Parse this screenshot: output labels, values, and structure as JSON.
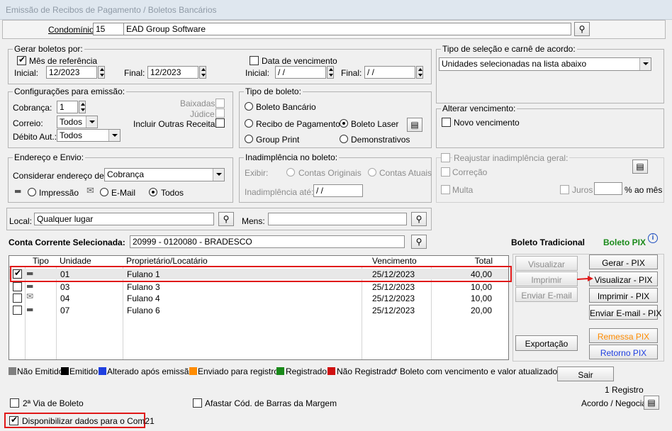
{
  "window": {
    "title": "Emissão de Recibos de Pagamento / Boletos Bancários"
  },
  "condominio": {
    "label": "Condomínio:",
    "code": "15",
    "name": "EAD Group Software"
  },
  "gerar": {
    "legend": "Gerar boletos por:",
    "mes_ref_label": "Mês de referência",
    "inicial_label": "Inicial:",
    "inicial": "12/2023",
    "final_label": "Final:",
    "final": "12/2023",
    "data_venc_label": "Data de vencimento",
    "venc_inicial_label": "Inicial:",
    "venc_inicial": " / /",
    "venc_final_label": "Final:",
    "venc_final": " / /"
  },
  "selecao": {
    "legend": "Tipo de seleção e carnê de acordo:",
    "value": "Unidades selecionadas na lista abaixo"
  },
  "config": {
    "legend": "Configurações para emissão:",
    "cobranca_label": "Cobrança:",
    "cobranca": "1",
    "correio_label": "Correio:",
    "correio": "Todos",
    "debito_label": "Débito Aut.:",
    "debito": "Todos",
    "baixadas": "Baixadas",
    "judice": "Júdice",
    "outras": "Incluir Outras Receitas"
  },
  "tipo_boleto": {
    "legend": "Tipo de boleto:",
    "bancario": "Boleto Bancário",
    "recibo": "Recibo de Pagamento",
    "laser": "Boleto Laser",
    "group": "Group Print",
    "demonstrativos": "Demonstrativos"
  },
  "alterar_venc": {
    "legend": "Alterar vencimento:",
    "novo": "Novo vencimento"
  },
  "endereco": {
    "legend": "Endereço e Envio:",
    "considerar_label": "Considerar endereço de:",
    "considerar": "Cobrança",
    "impressao": "Impressão",
    "email": "E-Mail",
    "todos": "Todos"
  },
  "inadimplencia": {
    "legend": "Inadimplência no boleto:",
    "exibir": "Exibir:",
    "originais": "Contas Originais",
    "atuais": "Contas Atuais",
    "ate_label": "Inadimplência até:",
    "ate": " / /"
  },
  "reajustar": {
    "legend": "Reajustar inadimplência geral:",
    "correcao": "Correção",
    "multa": "Multa",
    "juros": "Juros",
    "ao_mes": "% ao mês"
  },
  "local": {
    "label": "Local:",
    "value": "Qualquer lugar",
    "mens_label": "Mens:",
    "mens": ""
  },
  "conta": {
    "label": "Conta Corrente Selecionada:",
    "value": "20999 - 0120080 - BRADESCO"
  },
  "boleto_tradicional": "Boleto Tradicional",
  "boleto_pix": "Boleto PIX",
  "grid": {
    "headers": [
      "Tipo",
      "Unidade",
      "Proprietário/Locatário",
      "Vencimento",
      "Total"
    ],
    "rows": [
      {
        "checked": true,
        "tipo": "printer-icon",
        "unidade": "01",
        "nome": "Fulano 1",
        "venc": "25/12/2023",
        "total": "40,00"
      },
      {
        "checked": false,
        "tipo": "printer-icon",
        "unidade": "03",
        "nome": "Fulano 3",
        "venc": "25/12/2023",
        "total": "10,00"
      },
      {
        "checked": false,
        "tipo": "envelope-icon",
        "unidade": "04",
        "nome": "Fulano 4",
        "venc": "25/12/2023",
        "total": "10,00"
      },
      {
        "checked": false,
        "tipo": "printer-icon",
        "unidade": "07",
        "nome": "Fulano 6",
        "venc": "25/12/2023",
        "total": "20,00"
      }
    ]
  },
  "buttons": {
    "visualizar": "Visualizar",
    "imprimir": "Imprimir",
    "enviar_email": "Enviar E-mail",
    "exportacao": "Exportação",
    "gerar_pix": "Gerar - PIX",
    "visualizar_pix": "Visualizar - PIX",
    "imprimir_pix": "Imprimir - PIX",
    "enviar_email_pix": "Enviar E-mail - PIX",
    "remessa_pix": "Remessa PIX",
    "retorno_pix": "Retorno PIX",
    "sair": "Sair"
  },
  "status_legend": [
    {
      "label": "Não Emitido",
      "color": "#808080"
    },
    {
      "label": "Emitido",
      "color": "#000000"
    },
    {
      "label": "Alterado após emissão",
      "color": "#1f3fe0"
    },
    {
      "label": "Enviado para registro",
      "color": "#ff8c00"
    },
    {
      "label": "Registrado",
      "color": "#1a8a1a"
    },
    {
      "label": "Não Registrado",
      "color": "#d01010"
    }
  ],
  "legend_note": "* Boleto com vencimento e valor atualizados.",
  "registros": "1 Registro",
  "footer": {
    "segunda_via": "2ª Via de Boleto",
    "afastar": "Afastar Cód. de Barras da Margem",
    "acordo": "Acordo / Negociar",
    "com21": "Disponibilizar dados para o Com21"
  },
  "colors": {
    "pix_green": "#1a8a1a",
    "pix_orange": "#ff8c00",
    "pix_blue": "#1f3fe0",
    "highlight_red": "#e01818"
  }
}
